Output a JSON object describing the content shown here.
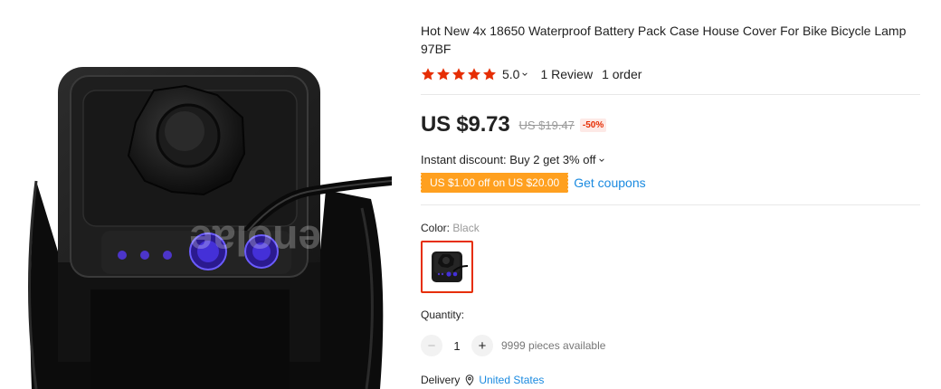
{
  "product": {
    "title": "Hot New 4x 18650 Waterproof Battery Pack Case House Cover For Bike Bicycle Lamp 97BF",
    "rating": "5.0",
    "reviews": "1 Review",
    "orders": "1 order",
    "watermark": "enolae"
  },
  "price": {
    "current": "US $9.73",
    "original": "US $19.47",
    "discount": "-50%"
  },
  "promo": {
    "instant_discount": "Instant discount: Buy 2 get 3% off",
    "coupon": "US $1.00 off on US $20.00",
    "get_coupons": "Get coupons"
  },
  "color": {
    "label": "Color:",
    "selected": "Black"
  },
  "quantity": {
    "label": "Quantity:",
    "value": "1",
    "available": "9999 pieces available",
    "minus": "−",
    "plus": "+"
  },
  "delivery": {
    "label": "Delivery",
    "location": "United States"
  },
  "colors": {
    "star": "#e62e04",
    "link": "#1a8ae0",
    "coupon_bg": "#ffa01f",
    "swatch_border": "#e62e04"
  },
  "icons": {
    "star": "star-icon",
    "caret": "chevron-down-icon",
    "pin": "location-pin-icon"
  }
}
